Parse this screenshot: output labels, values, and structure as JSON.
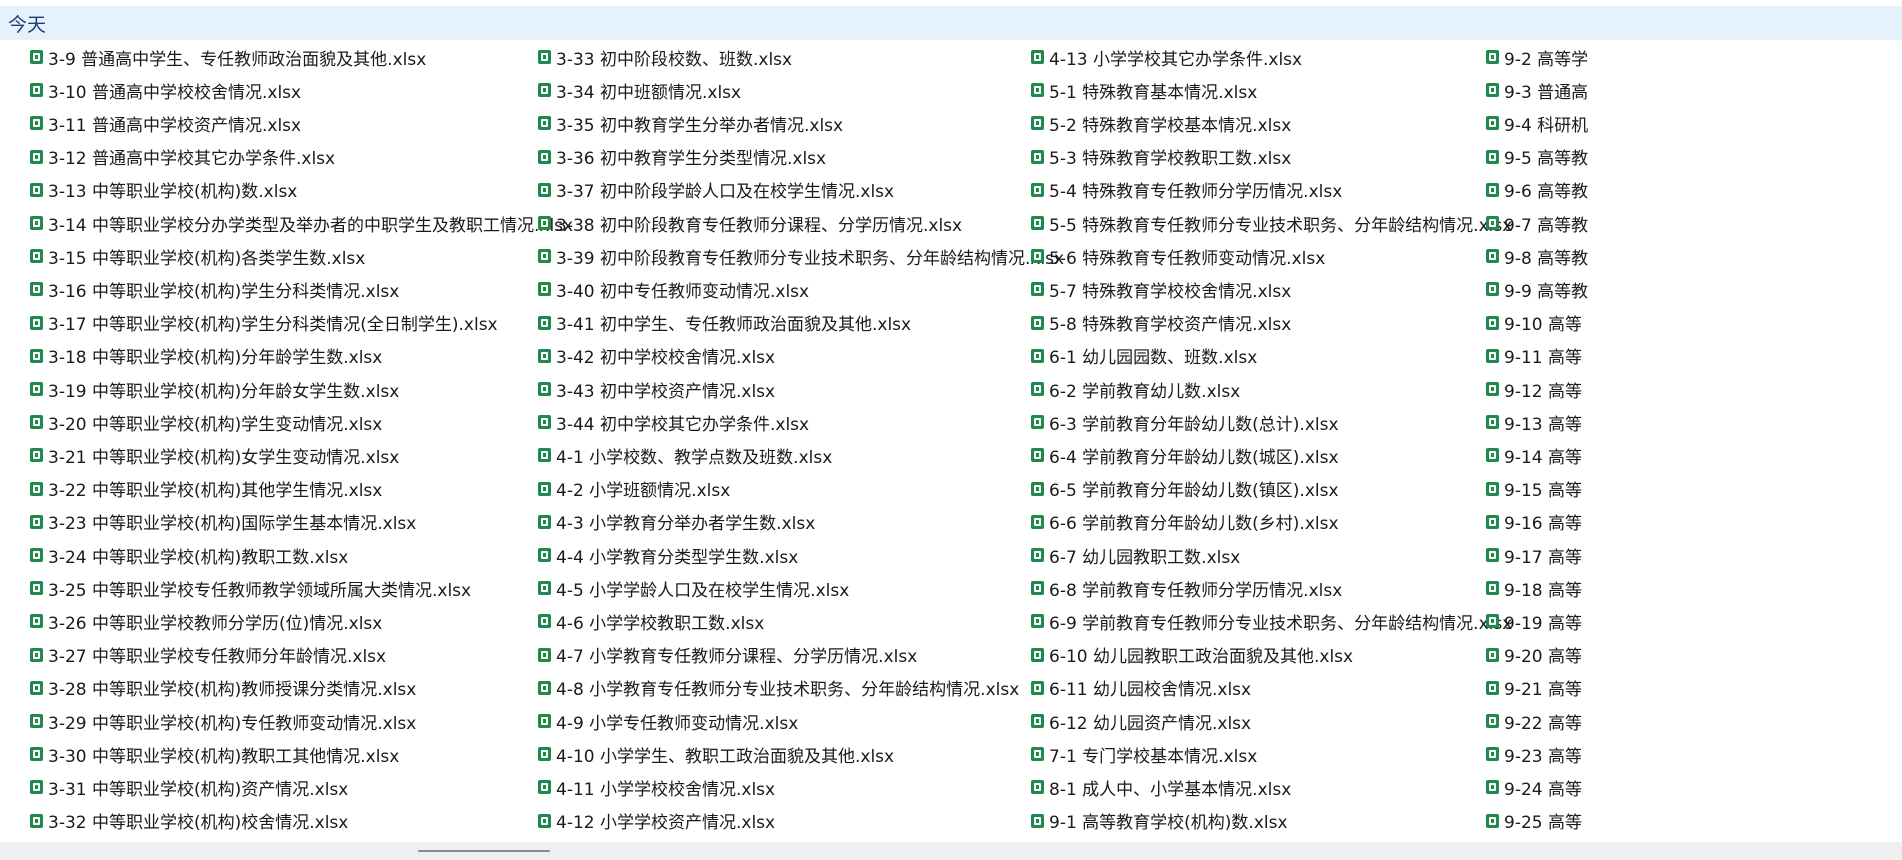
{
  "group": {
    "label": "今天"
  },
  "icon": "excel-file-icon",
  "columns": [
    {
      "items": [
        "3-9 普通高中学生、专任教师政治面貌及其他.xlsx",
        "3-10 普通高中学校校舍情况.xlsx",
        "3-11 普通高中学校资产情况.xlsx",
        "3-12 普通高中学校其它办学条件.xlsx",
        "3-13 中等职业学校(机构)数.xlsx",
        "3-14 中等职业学校分办学类型及举办者的中职学生及教职工情况.xlsx",
        "3-15 中等职业学校(机构)各类学生数.xlsx",
        "3-16 中等职业学校(机构)学生分科类情况.xlsx",
        "3-17 中等职业学校(机构)学生分科类情况(全日制学生).xlsx",
        "3-18 中等职业学校(机构)分年龄学生数.xlsx",
        "3-19 中等职业学校(机构)分年龄女学生数.xlsx",
        "3-20 中等职业学校(机构)学生变动情况.xlsx",
        "3-21 中等职业学校(机构)女学生变动情况.xlsx",
        "3-22 中等职业学校(机构)其他学生情况.xlsx",
        "3-23 中等职业学校(机构)国际学生基本情况.xlsx",
        "3-24 中等职业学校(机构)教职工数.xlsx",
        "3-25 中等职业学校专任教师教学领域所属大类情况.xlsx",
        "3-26 中等职业学校教师分学历(位)情况.xlsx",
        "3-27 中等职业学校专任教师分年龄情况.xlsx",
        "3-28 中等职业学校(机构)教师授课分类情况.xlsx",
        "3-29 中等职业学校(机构)专任教师变动情况.xlsx",
        "3-30 中等职业学校(机构)教职工其他情况.xlsx",
        "3-31 中等职业学校(机构)资产情况.xlsx",
        "3-32 中等职业学校(机构)校舍情况.xlsx"
      ]
    },
    {
      "items": [
        "3-33 初中阶段校数、班数.xlsx",
        "3-34 初中班额情况.xlsx",
        "3-35 初中教育学生分举办者情况.xlsx",
        "3-36 初中教育学生分类型情况.xlsx",
        "3-37 初中阶段学龄人口及在校学生情况.xlsx",
        "3-38 初中阶段教育专任教师分课程、分学历情况.xlsx",
        "3-39 初中阶段教育专任教师分专业技术职务、分年龄结构情况.xlsx",
        "3-40 初中专任教师变动情况.xlsx",
        "3-41 初中学生、专任教师政治面貌及其他.xlsx",
        "3-42 初中学校校舍情况.xlsx",
        "3-43 初中学校资产情况.xlsx",
        "3-44 初中学校其它办学条件.xlsx",
        "4-1 小学校数、教学点数及班数.xlsx",
        "4-2 小学班额情况.xlsx",
        "4-3 小学教育分举办者学生数.xlsx",
        "4-4 小学教育分类型学生数.xlsx",
        "4-5 小学学龄人口及在校学生情况.xlsx",
        "4-6 小学学校教职工数.xlsx",
        "4-7 小学教育专任教师分课程、分学历情况.xlsx",
        "4-8 小学教育专任教师分专业技术职务、分年龄结构情况.xlsx",
        "4-9 小学专任教师变动情况.xlsx",
        "4-10 小学学生、教职工政治面貌及其他.xlsx",
        "4-11 小学学校校舍情况.xlsx",
        "4-12 小学学校资产情况.xlsx"
      ]
    },
    {
      "items": [
        "4-13 小学学校其它办学条件.xlsx",
        "5-1 特殊教育基本情况.xlsx",
        "5-2 特殊教育学校基本情况.xlsx",
        "5-3 特殊教育学校教职工数.xlsx",
        "5-4 特殊教育专任教师分学历情况.xlsx",
        "5-5 特殊教育专任教师分专业技术职务、分年龄结构情况.xlsx",
        "5-6 特殊教育专任教师变动情况.xlsx",
        "5-7 特殊教育学校校舍情况.xlsx",
        "5-8 特殊教育学校资产情况.xlsx",
        "6-1 幼儿园园数、班数.xlsx",
        "6-2 学前教育幼儿数.xlsx",
        "6-3 学前教育分年龄幼儿数(总计).xlsx",
        "6-4 学前教育分年龄幼儿数(城区).xlsx",
        "6-5 学前教育分年龄幼儿数(镇区).xlsx",
        "6-6 学前教育分年龄幼儿数(乡村).xlsx",
        "6-7 幼儿园教职工数.xlsx",
        "6-8 学前教育专任教师分学历情况.xlsx",
        "6-9 学前教育专任教师分专业技术职务、分年龄结构情况.xlsx",
        "6-10 幼儿园教职工政治面貌及其他.xlsx",
        "6-11 幼儿园校舍情况.xlsx",
        "6-12 幼儿园资产情况.xlsx",
        "7-1 专门学校基本情况.xlsx",
        "8-1 成人中、小学基本情况.xlsx",
        "9-1 高等教育学校(机构)数.xlsx"
      ]
    },
    {
      "items": [
        "9-2 高等学",
        "9-3 普通高",
        "9-4 科研机",
        "9-5 高等教",
        "9-6 高等教",
        "9-7 高等教",
        "9-8 高等教",
        "9-9 高等教",
        "9-10 高等",
        "9-11 高等",
        "9-12 高等",
        "9-13 高等",
        "9-14 高等",
        "9-15 高等",
        "9-16 高等",
        "9-17 高等",
        "9-18 高等",
        "9-19 高等",
        "9-20 高等",
        "9-21 高等",
        "9-22 高等",
        "9-23 高等",
        "9-24 高等",
        "9-25 高等"
      ]
    }
  ]
}
